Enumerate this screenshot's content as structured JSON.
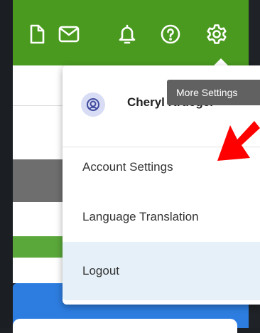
{
  "header": {
    "icons": [
      "document-icon",
      "mail-icon",
      "bell-icon",
      "help-icon",
      "gear-icon"
    ],
    "color": "#4a9a1f"
  },
  "menu": {
    "user_name": "Cheryl Krueger",
    "items": [
      {
        "label": "Account Settings"
      },
      {
        "label": "Language Translation"
      },
      {
        "label": "Logout"
      }
    ],
    "hover_color": "#e6f0f8"
  },
  "tooltip": {
    "text": "More Settings"
  },
  "annotation": {
    "color": "#ff0000"
  }
}
